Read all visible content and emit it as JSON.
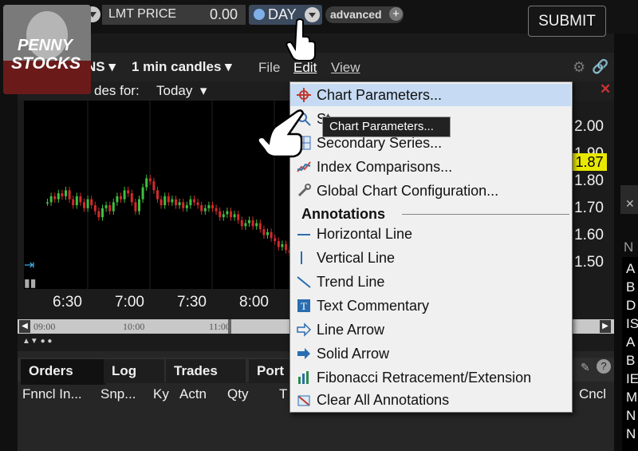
{
  "order_bar": {
    "order_type": "LMT PRICE",
    "price": "0.00",
    "tif": "DAY",
    "advanced": "advanced",
    "submit": "SUBMIT"
  },
  "logo": {
    "line1": "PENNY",
    "line2": "STOCKS"
  },
  "chart_window": {
    "symbol_suffix": "NS",
    "interval": "1 min candles",
    "menus": {
      "file": "File",
      "edit": "Edit",
      "view": "View"
    },
    "candles_for_label": "des for:",
    "candles_for_value": "Today",
    "last_price": "1.87"
  },
  "chart_data": {
    "type": "candlestick",
    "x_ticks": [
      "6:30",
      "7:00",
      "7:30",
      "8:00"
    ],
    "y_ticks": [
      "2.00",
      "1.90",
      "1.80",
      "1.70",
      "1.60",
      "1.50"
    ],
    "ylim": [
      1.42,
      2.05
    ],
    "last_price": 1.87,
    "up_color": "#3fbf3f",
    "down_color": "#d22b2b",
    "closes": [
      1.71,
      1.73,
      1.72,
      1.74,
      1.73,
      1.75,
      1.72,
      1.7,
      1.73,
      1.71,
      1.69,
      1.72,
      1.7,
      1.68,
      1.66,
      1.69,
      1.7,
      1.68,
      1.71,
      1.73,
      1.72,
      1.75,
      1.74,
      1.71,
      1.68,
      1.72,
      1.76,
      1.79,
      1.78,
      1.75,
      1.72,
      1.7,
      1.73,
      1.71,
      1.72,
      1.7,
      1.71,
      1.69,
      1.7,
      1.72,
      1.71,
      1.7,
      1.68,
      1.69,
      1.7,
      1.69,
      1.68,
      1.66,
      1.67,
      1.68,
      1.66,
      1.67,
      1.65,
      1.63,
      1.64,
      1.65,
      1.63,
      1.64,
      1.62,
      1.6,
      1.61,
      1.59,
      1.58,
      1.56,
      1.57,
      1.55,
      1.54
    ]
  },
  "navigator": {
    "ticks": [
      "09:00",
      "10:00",
      "11:00"
    ]
  },
  "edit_menu": {
    "items": [
      {
        "label": "Chart Parameters...",
        "icon": "crosshair-icon",
        "highlighted": true
      },
      {
        "label": "St...",
        "icon": "magnifier-icon"
      },
      {
        "label": "Secondary Series...",
        "icon": "grid-icon"
      },
      {
        "label": "Index Comparisons...",
        "icon": "trend-chart-icon"
      },
      {
        "label": "Global Chart Configuration...",
        "icon": "wrench-icon"
      }
    ],
    "section_header": "Annotations",
    "annotations": [
      {
        "label": "Horizontal Line",
        "icon": "horizontal-line-icon"
      },
      {
        "label": "Vertical Line",
        "icon": "vertical-line-icon"
      },
      {
        "label": "Trend Line",
        "icon": "trend-line-icon"
      },
      {
        "label": "Text Commentary",
        "icon": "text-icon"
      },
      {
        "label": "Line Arrow",
        "icon": "line-arrow-icon"
      },
      {
        "label": "Solid Arrow",
        "icon": "solid-arrow-icon"
      },
      {
        "label": "Fibonacci Retracement/Extension",
        "icon": "fibonacci-icon"
      },
      {
        "label": "Clear All Annotations",
        "icon": "clear-annotations-icon"
      }
    ],
    "tooltip": "Chart Parameters..."
  },
  "bottom_panel": {
    "tabs": [
      "Orders",
      "Log",
      "Trades",
      "Port"
    ],
    "columns": [
      "Fnncl In...",
      "Snp...",
      "Ky",
      "Actn",
      "Qty",
      "T",
      "Cncl"
    ]
  },
  "right_panel": {
    "letters": [
      "N",
      "A",
      "B",
      "D",
      "IS",
      "A",
      "B",
      "IE",
      "M",
      "N",
      "N"
    ]
  }
}
